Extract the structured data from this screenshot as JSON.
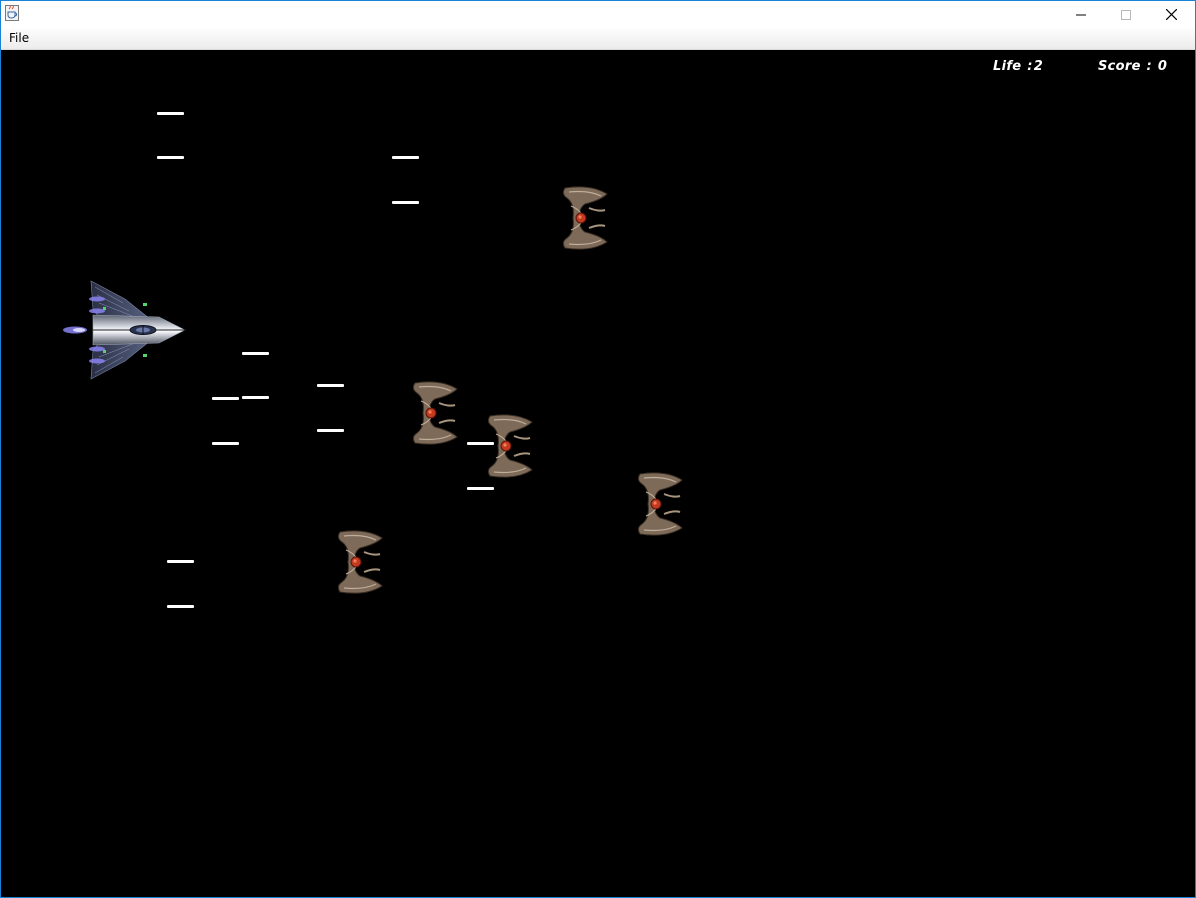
{
  "window": {
    "title": "",
    "menu": {
      "file_label": "File"
    }
  },
  "hud": {
    "life_label": "Life",
    "life_value": "2",
    "score_label": "Score",
    "score_value": "0"
  },
  "icons": {
    "app": "java-cup-icon",
    "minimize": "minimize-icon",
    "maximize": "maximize-icon",
    "close": "close-icon"
  },
  "colors": {
    "background": "#000000",
    "hud_text": "#ffffff",
    "bullet": "#ffffff",
    "window_border": "#1883d7"
  },
  "game": {
    "player": "player-spaceship",
    "enemy_count": 5,
    "bullet_count": 14
  }
}
